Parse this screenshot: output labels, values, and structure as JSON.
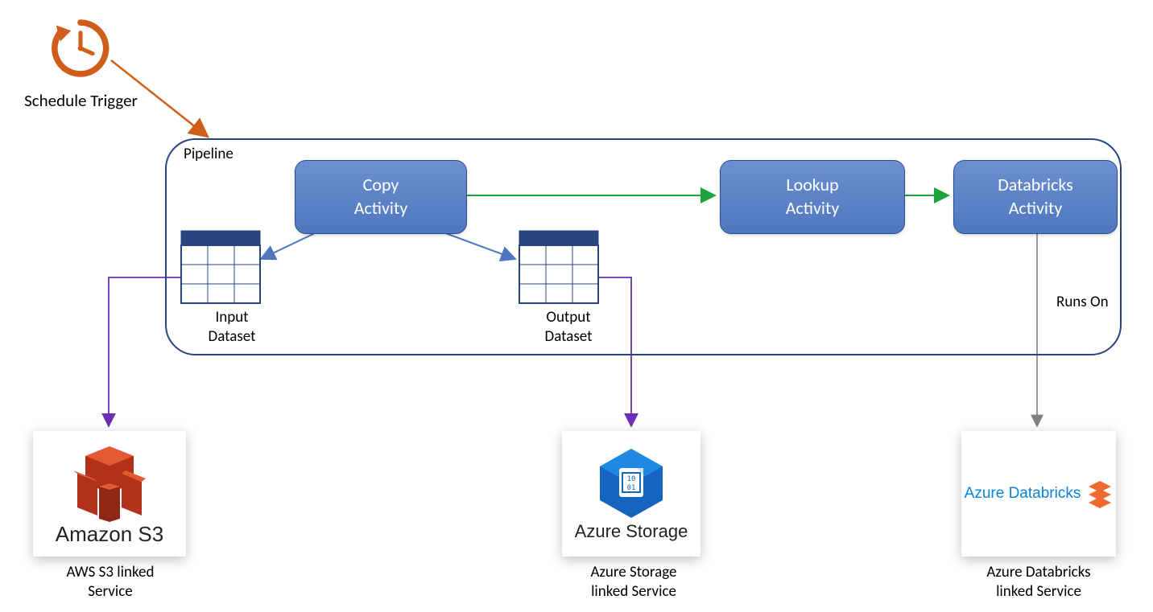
{
  "schedule_trigger": "Schedule Trigger",
  "pipeline_label": "Pipeline",
  "activities": {
    "copy": "Copy\nActivity",
    "lookup": "Lookup\nActivity",
    "databricks": "Databricks\nActivity"
  },
  "input_dataset": "Input\nDataset",
  "output_dataset": "Output\nDataset",
  "runs_on": "Runs On",
  "services": {
    "s3": {
      "card": "Amazon S3",
      "label": "AWS S3 linked\nService"
    },
    "storage": {
      "card": "Azure Storage",
      "label": "Azure Storage\nlinked Service"
    },
    "adb": {
      "card": "Azure Databricks",
      "label": "Azure Databricks\nlinked Service"
    }
  },
  "colors": {
    "orange": "#d05e1a",
    "blue": "#4f77bf",
    "darkblue": "#27447C",
    "green": "#1aa53c",
    "purple": "#6b2fb7",
    "grey": "#7f7f7f"
  }
}
